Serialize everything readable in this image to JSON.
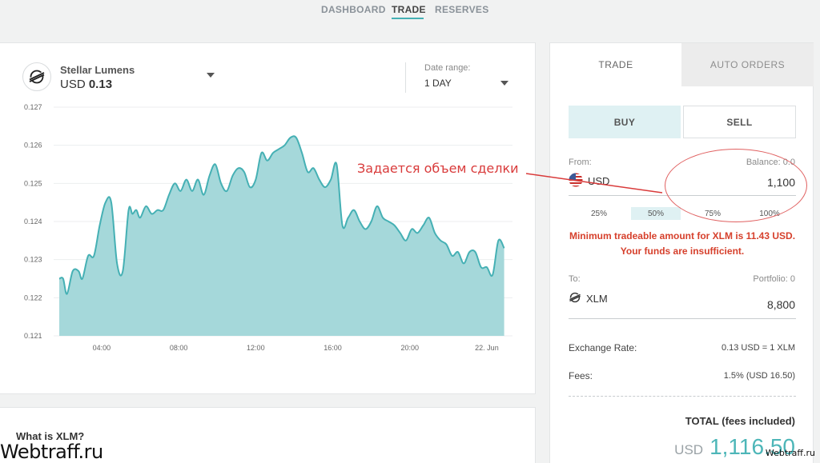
{
  "nav": {
    "items": [
      {
        "label": "DASHBOARD"
      },
      {
        "label": "TRADE",
        "active": true
      },
      {
        "label": "RESERVES"
      }
    ]
  },
  "asset": {
    "name": "Stellar Lumens",
    "currency": "USD",
    "price": "0.13",
    "icon": "stellar-logo-icon"
  },
  "date_range": {
    "label": "Date range:",
    "value": "1 DAY"
  },
  "chart_data": {
    "type": "area",
    "color": "#45b0b4",
    "fill": "#a5d8da",
    "ylim": [
      0.121,
      0.127
    ],
    "y_ticks": [
      "0.127",
      "0.126",
      "0.125",
      "0.124",
      "0.123",
      "0.122",
      "0.121"
    ],
    "x_ticks": [
      "04:00",
      "08:00",
      "12:00",
      "16:00",
      "20:00",
      "22. Jun"
    ],
    "x_tick_hours": [
      4,
      8,
      12,
      16,
      20,
      24
    ],
    "x_range": [
      1.8,
      25.0
    ],
    "x": [
      1.8,
      2.0,
      2.2,
      2.5,
      2.8,
      3.0,
      3.3,
      3.6,
      3.9,
      4.2,
      4.5,
      4.8,
      5.1,
      5.4,
      5.6,
      5.8,
      6.0,
      6.3,
      6.6,
      6.9,
      7.2,
      7.5,
      7.8,
      8.1,
      8.4,
      8.7,
      9.0,
      9.3,
      9.6,
      9.9,
      10.2,
      10.5,
      10.8,
      11.1,
      11.4,
      11.7,
      12.0,
      12.3,
      12.6,
      12.9,
      13.2,
      13.5,
      13.8,
      14.1,
      14.4,
      14.7,
      15.0,
      15.3,
      15.6,
      15.9,
      16.2,
      16.5,
      16.8,
      17.1,
      17.4,
      17.7,
      18.0,
      18.3,
      18.6,
      18.9,
      19.2,
      19.5,
      19.8,
      20.1,
      20.4,
      20.7,
      21.0,
      21.3,
      21.6,
      21.9,
      22.2,
      22.5,
      22.8,
      23.1,
      23.4,
      23.7,
      24.0,
      24.3,
      24.6,
      24.9
    ],
    "y": [
      0.1225,
      0.1225,
      0.1221,
      0.1227,
      0.1227,
      0.1225,
      0.1231,
      0.1231,
      0.1239,
      0.1245,
      0.1245,
      0.1229,
      0.1227,
      0.1243,
      0.1242,
      0.1243,
      0.1241,
      0.1244,
      0.1242,
      0.1243,
      0.1243,
      0.1247,
      0.125,
      0.1248,
      0.1251,
      0.1248,
      0.1251,
      0.1247,
      0.1252,
      0.1255,
      0.125,
      0.1248,
      0.1252,
      0.1254,
      0.1253,
      0.1249,
      0.1251,
      0.1258,
      0.1256,
      0.1258,
      0.1259,
      0.126,
      0.1262,
      0.1262,
      0.1258,
      0.1253,
      0.1254,
      0.1251,
      0.1249,
      0.1251,
      0.1255,
      0.1239,
      0.1241,
      0.1243,
      0.124,
      0.1238,
      0.124,
      0.1244,
      0.1241,
      0.124,
      0.1239,
      0.1237,
      0.1235,
      0.1238,
      0.1237,
      0.1239,
      0.1241,
      0.1237,
      0.1235,
      0.1234,
      0.1231,
      0.1232,
      0.1229,
      0.1232,
      0.1232,
      0.1228,
      0.1228,
      0.1226,
      0.1235,
      0.1233
    ]
  },
  "trade": {
    "tabs": [
      {
        "label": "TRADE",
        "active": true
      },
      {
        "label": "AUTO ORDERS"
      }
    ],
    "buy_label": "BUY",
    "sell_label": "SELL",
    "from_label": "From:",
    "balance_label": "Balance: 0.0",
    "from_currency": "USD",
    "from_icon": "us-flag-icon",
    "from_amount": "1,100",
    "percents": [
      "25%",
      "50%",
      "75%",
      "100%"
    ],
    "selected_percent": "50%",
    "error": "Minimum tradeable amount for XLM is 11.43 USD. Your funds are insufficient.",
    "to_label": "To:",
    "portfolio_label": "Portfolio: 0",
    "to_currency": "XLM",
    "to_icon": "stellar-logo-icon",
    "to_amount": "8,800",
    "exchange_label": "Exchange Rate:",
    "exchange_value": "0.13 USD = 1 XLM",
    "fees_label": "Fees:",
    "fees_value": "1.5% (USD 16.50)",
    "total_label": "TOTAL (fees included)",
    "total_currency": "USD",
    "total_value": "1,116.50"
  },
  "info": {
    "title": "What is XLM?"
  },
  "annotation": {
    "text": "Задается объем сделки",
    "color": "#d93b3b"
  },
  "watermark": {
    "left": "Webtraff.ru",
    "right": "Webtraff.ru"
  }
}
